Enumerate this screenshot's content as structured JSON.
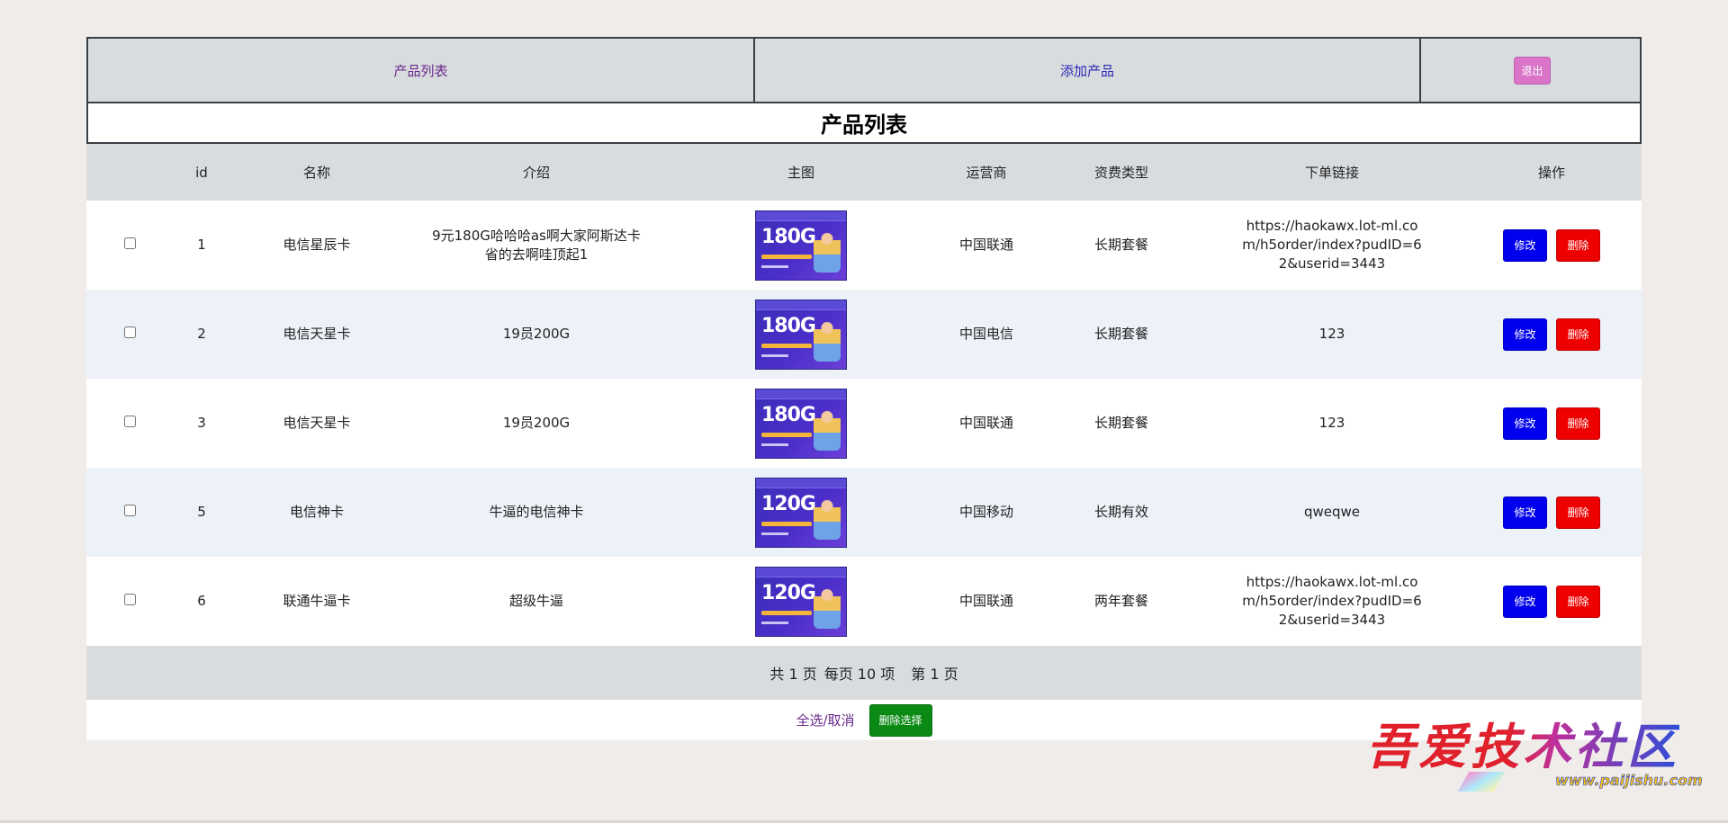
{
  "nav": {
    "product_list": "产品列表",
    "add_product": "添加产品",
    "logout": "退出"
  },
  "page_title": "产品列表",
  "table": {
    "headers": [
      "",
      "id",
      "名称",
      "介绍",
      "主图",
      "运营商",
      "资费类型",
      "下单链接",
      "操作"
    ],
    "rows": [
      {
        "id": "1",
        "name": "电信星辰卡",
        "intro": "9元180G哈哈哈as啊大家阿斯达卡省的去啊哇顶起1",
        "image_label": "180G",
        "carrier": "中国联通",
        "plan": "长期套餐",
        "link": "https://haokawx.lot-ml.com/h5order/index?pudID=62&userid=3443",
        "style": "white"
      },
      {
        "id": "2",
        "name": "电信天星卡",
        "intro": "19员200G",
        "image_label": "180G",
        "carrier": "中国电信",
        "plan": "长期套餐",
        "link": "123",
        "style": "alt"
      },
      {
        "id": "3",
        "name": "电信天星卡",
        "intro": "19员200G",
        "image_label": "180G",
        "carrier": "中国联通",
        "plan": "长期套餐",
        "link": "123",
        "style": "white"
      },
      {
        "id": "5",
        "name": "电信神卡",
        "intro": "牛逼的电信神卡",
        "image_label": "120G",
        "carrier": "中国移动",
        "plan": "长期有效",
        "link": "qweqwe",
        "style": "alt"
      },
      {
        "id": "6",
        "name": "联通牛逼卡",
        "intro": "超级牛逼",
        "image_label": "120G",
        "carrier": "中国联通",
        "plan": "两年套餐",
        "link": "https://haokawx.lot-ml.com/h5order/index?pudID=62&userid=3443",
        "style": "white"
      }
    ],
    "edit_label": "修改",
    "delete_label": "删除"
  },
  "pager": {
    "total_pages": "共 1 页",
    "per_page": "每页 10 项",
    "current": "第 1 页"
  },
  "footer": {
    "select_all": "全选/取消",
    "delete_selected": "删除选择"
  },
  "watermark": {
    "title": "吾爱技术社区",
    "url": "www.paijishu.com"
  },
  "colors": {
    "edit": "#0000ee",
    "delete": "#ee0000",
    "delete_selected": "#0a8a14",
    "logout": "#d974c8"
  }
}
